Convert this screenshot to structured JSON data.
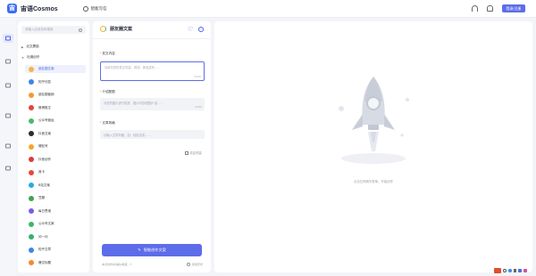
{
  "app": {
    "logo_mark": "宙",
    "name": "宙语Cosmos"
  },
  "topbar": {
    "tab_label": "智能写信",
    "login_label": "登录/注册",
    "icons": [
      "headset-icon",
      "bell-icon"
    ]
  },
  "rail": {
    "icons": [
      "home-icon",
      "cloud-icon",
      "location-icon",
      "book-icon",
      "chat-icon",
      "storage-icon"
    ]
  },
  "sidebar": {
    "search_placeholder": "请输入应用名称搜索",
    "groups": [
      {
        "label": "近文履能",
        "expanded": false
      },
      {
        "label": "社媒创作",
        "expanded": true
      }
    ],
    "items": [
      {
        "label": "朋友圈文案",
        "color": "#f6b443",
        "active": true
      },
      {
        "label": "知乎问答",
        "color": "#3a86e8"
      },
      {
        "label": "朋友圈营销",
        "color": "#f29a2e"
      },
      {
        "label": "微博推文",
        "color": "#e1453f"
      },
      {
        "label": "公众号营运",
        "color": "#4ab96b"
      },
      {
        "label": "抖音文案",
        "color": "#2b2b2b"
      },
      {
        "label": "微贴号",
        "color": "#f5a623"
      },
      {
        "label": "抖音创作",
        "color": "#d93b3b"
      },
      {
        "label": "音卡",
        "color": "#e8483e"
      },
      {
        "label": "B站文案",
        "color": "#28a9e0"
      },
      {
        "label": "豆瓣",
        "color": "#3fa34d"
      },
      {
        "label": "每日思维",
        "color": "#7b5ce6"
      },
      {
        "label": "公众号文案",
        "color": "#3db66a"
      },
      {
        "label": "问一问",
        "color": "#33b06b"
      },
      {
        "label": "知乎文章",
        "color": "#3a86e8"
      },
      {
        "label": "爆文标题",
        "color": "#f28a2e"
      }
    ]
  },
  "form": {
    "title": "朋友圈文案",
    "fields": [
      {
        "label": "发文内容",
        "required": true,
        "placeholder": "请填写您的发文内容、例如：新品发布……",
        "counter": "0/200"
      },
      {
        "label": "介绍配图",
        "required": true,
        "placeholder": "请您的图片进行描述、图片内容/配图介绍……",
        "counter": "0/200"
      },
      {
        "label": "文章风格",
        "required": true,
        "placeholder": "请输入文章风格、如：轻松活泼……"
      }
    ],
    "clear_label": "清空内容",
    "generate_label": "智能创作文案",
    "footnote": "本次创作将消耗2额度，?",
    "history_label": "使用历史"
  },
  "result": {
    "empty_text": "点击左侧填写表单、开始创作"
  }
}
